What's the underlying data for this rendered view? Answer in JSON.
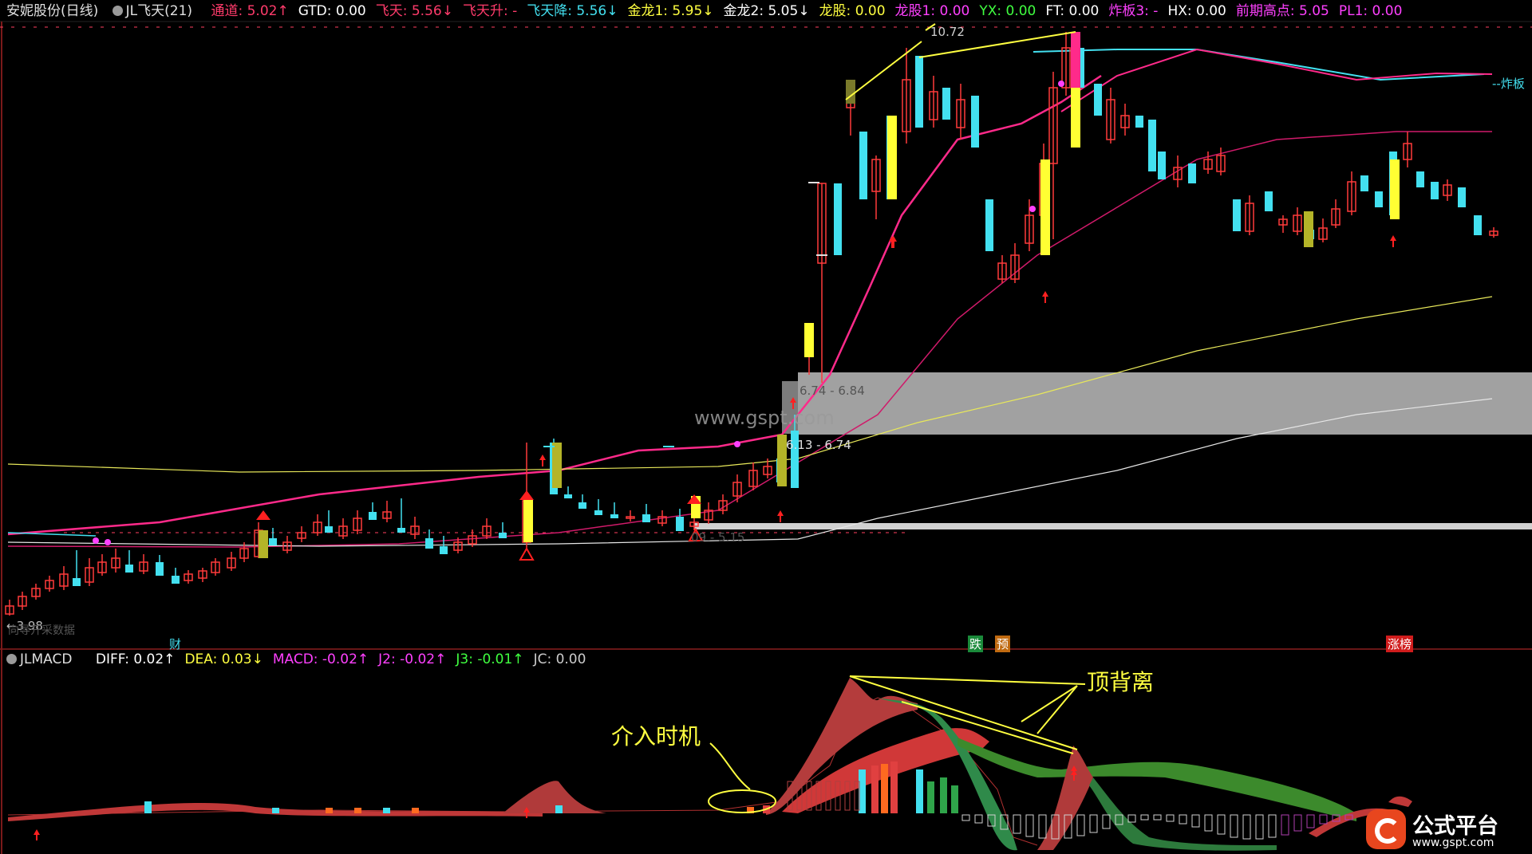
{
  "main_header": {
    "stock": "安妮股份(日线)",
    "indicator": "JL飞天(21)",
    "items": [
      {
        "text": "通道: 5.02↑",
        "color": "#ff3b6b"
      },
      {
        "text": "GTD: 0.00",
        "color": "#ffffff"
      },
      {
        "text": "飞天: 5.56↓",
        "color": "#ff3b6b"
      },
      {
        "text": "飞天升: -",
        "color": "#ff3b6b"
      },
      {
        "text": "飞天降: 5.56↓",
        "color": "#43e0f0"
      },
      {
        "text": "金龙1: 5.95↓",
        "color": "#ffff40"
      },
      {
        "text": "金龙2: 5.05↓",
        "color": "#ffffff"
      },
      {
        "text": "龙股: 0.00",
        "color": "#ffff40"
      },
      {
        "text": "龙股1: 0.00",
        "color": "#ff40ff"
      },
      {
        "text": "YX: 0.00",
        "color": "#40ff40"
      },
      {
        "text": "FT: 0.00",
        "color": "#ffffff"
      },
      {
        "text": "炸板3: -",
        "color": "#ff40ff"
      },
      {
        "text": "HX: 0.00",
        "color": "#ffffff"
      },
      {
        "text": "前期高点: 5.05",
        "color": "#ff40ff"
      },
      {
        "text": "PL1: 0.00",
        "color": "#ff40ff"
      }
    ]
  },
  "sub_header": {
    "indicator": "JLMACD",
    "items": [
      {
        "text": "DIFF: 0.02↑",
        "color": "#ffffff"
      },
      {
        "text": "DEA: 0.03↓",
        "color": "#ffff40"
      },
      {
        "text": "MACD: -0.02↑",
        "color": "#ff40ff"
      },
      {
        "text": "J2: -0.02↑",
        "color": "#ff40ff"
      },
      {
        "text": "J3: -0.01↑",
        "color": "#40ff40"
      },
      {
        "text": "JC: 0.00",
        "color": "#cccccc"
      }
    ]
  },
  "labels": {
    "high_price": "10.72",
    "zhaban": "--炸板",
    "zone_upper": "6.74 - 6.84",
    "zone_mid": "6.13 - 6.74",
    "zone_lower": "09 - 5.15",
    "low_price": "3.98",
    "no_data": "向导开采数据",
    "watermark": "www.gspt.com",
    "event_cai": "财",
    "event_die": "跌",
    "event_yu": "预",
    "event_zhangbang": "涨榜",
    "annot_divergence": "顶背离",
    "annot_entry": "介入时机"
  },
  "logo": {
    "title": "公式平台",
    "url": "www.gspt.com"
  },
  "colors": {
    "up": "#ff3b3b",
    "down": "#43e0f0",
    "yellow": "#ffff33",
    "magenta": "#ff2a8a",
    "white": "#e0e0e0"
  }
}
